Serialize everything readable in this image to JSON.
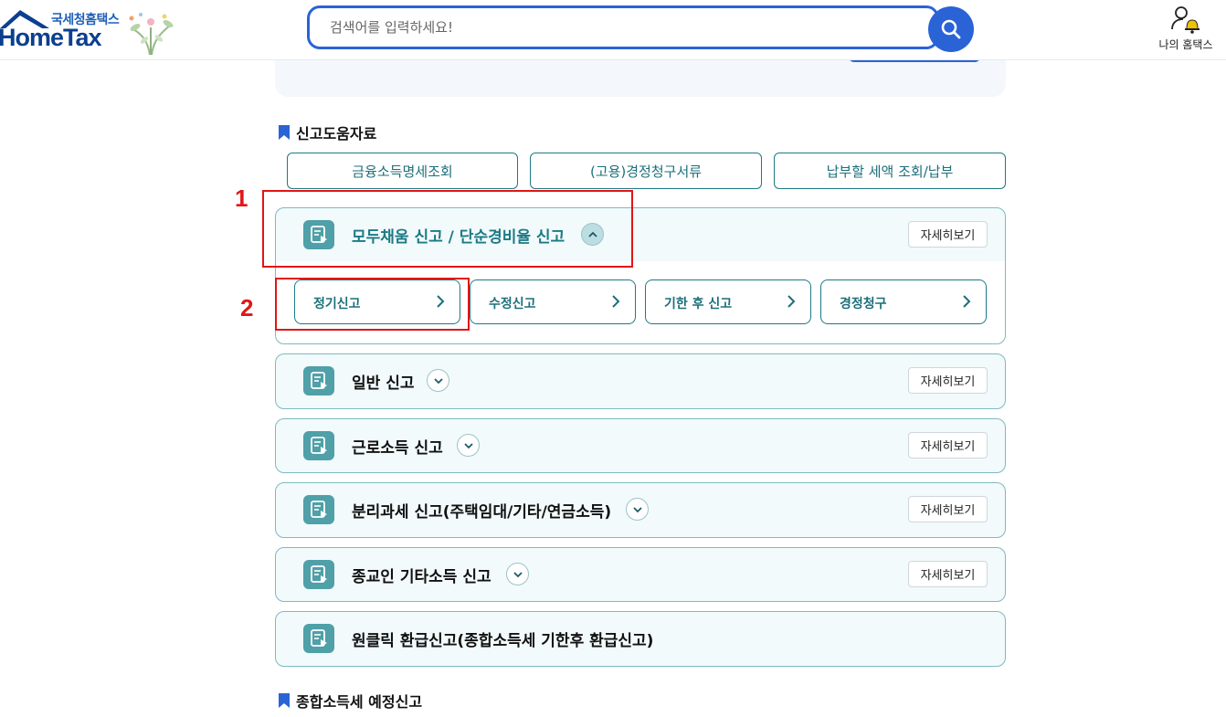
{
  "header": {
    "logo_kr": "국세청홈택스",
    "logo_en": "HomeTax",
    "search_placeholder": "검색어를 입력하세요!",
    "my_home_label": "나의 홈택스"
  },
  "sections": {
    "help_title": "신고도움자료",
    "estimate_title": "종합소득세 예정신고"
  },
  "help_buttons": [
    "금융소득명세조회",
    "(고용)경정청구서류",
    "납부할 세액 조회/납부"
  ],
  "panels": [
    {
      "title": "모두채움 신고 / 단순경비율 신고",
      "detail": "자세히보기",
      "expanded": true,
      "sub_items": [
        "정기신고",
        "수정신고",
        "기한 후 신고",
        "경정청구"
      ]
    },
    {
      "title": "일반 신고",
      "detail": "자세히보기",
      "expanded": false
    },
    {
      "title": "근로소득 신고",
      "detail": "자세히보기",
      "expanded": false
    },
    {
      "title": "분리과세 신고(주택임대/기타/연금소득)",
      "detail": "자세히보기",
      "expanded": false
    },
    {
      "title": "종교인 기타소득 신고",
      "detail": "자세히보기",
      "expanded": false
    },
    {
      "title": "원클릭 환급신고(종합소득세 기한후 환급신고)",
      "expanded": false
    }
  ],
  "annotations": [
    "1",
    "2"
  ],
  "colors": {
    "accent": "#2a63d6",
    "teal": "#1c7a85",
    "panel_bg": "#f2fafb",
    "annotation": "#e01616"
  }
}
